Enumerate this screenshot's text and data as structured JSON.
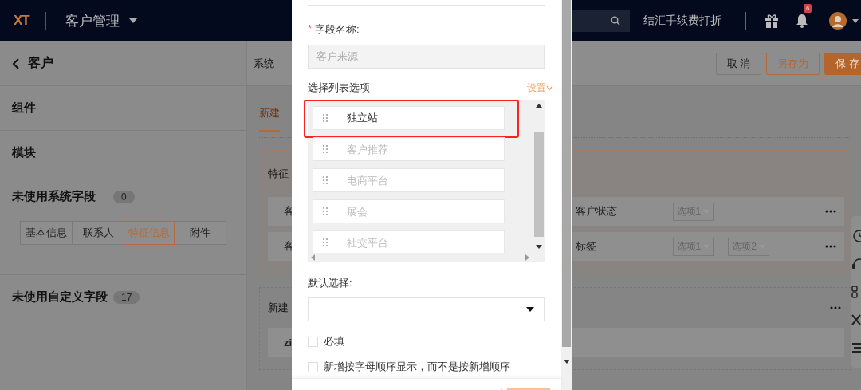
{
  "header": {
    "logo": "XT",
    "app": "客户管理",
    "promo": "结汇手续费打折",
    "notifications": "6"
  },
  "sidebar": {
    "back": "客户",
    "sections": [
      {
        "title": "组件"
      },
      {
        "title": "模块"
      }
    ],
    "system_fields": {
      "title": "未使用系统字段",
      "count": "0",
      "tabs": [
        {
          "label": "基本信息",
          "selected": false
        },
        {
          "label": "联系人",
          "selected": false
        },
        {
          "label": "特征信息",
          "selected": true
        },
        {
          "label": "附件",
          "selected": false
        }
      ]
    },
    "custom_fields": {
      "title": "未使用自定义字段",
      "count": "17"
    }
  },
  "toolbar": {
    "label": "系统",
    "buttons": [
      {
        "label": "取 消",
        "kind": "plain"
      },
      {
        "label": "另存为",
        "kind": "outline"
      },
      {
        "label": "保 存",
        "kind": "primary"
      }
    ]
  },
  "tabs": [
    {
      "label": "新建",
      "selected": true
    }
  ],
  "sections": [
    {
      "title": "特征",
      "selected": true,
      "rows": [
        {
          "label": "客",
          "field": "客户状态",
          "options": [
            "选项1"
          ]
        },
        {
          "label": "客",
          "field": "标签",
          "options": [
            "选项1",
            "选项2"
          ]
        }
      ]
    },
    {
      "title": "新建",
      "selected": false,
      "rows": [
        {
          "label": "zi"
        }
      ]
    }
  ],
  "dialog": {
    "required_mark": "*",
    "name_label": "字段名称:",
    "name_field": {
      "value": "客户来源",
      "disabled": true
    },
    "options_label": "选择列表选项",
    "settings_link": "设置",
    "options": [
      {
        "value": "独立站",
        "highlighted": true
      },
      {
        "placeholder": "客户推荐",
        "highlighted": false
      },
      {
        "placeholder": "电商平台",
        "highlighted": false
      },
      {
        "placeholder": "展会",
        "highlighted": false
      },
      {
        "placeholder": "社交平台",
        "highlighted": false
      }
    ],
    "default_label": "默认选择:",
    "checkboxes": [
      {
        "label": "必填",
        "checked": false
      },
      {
        "label": "新增按字母顺序显示，而不是按新增顺序",
        "checked": false
      }
    ]
  }
}
